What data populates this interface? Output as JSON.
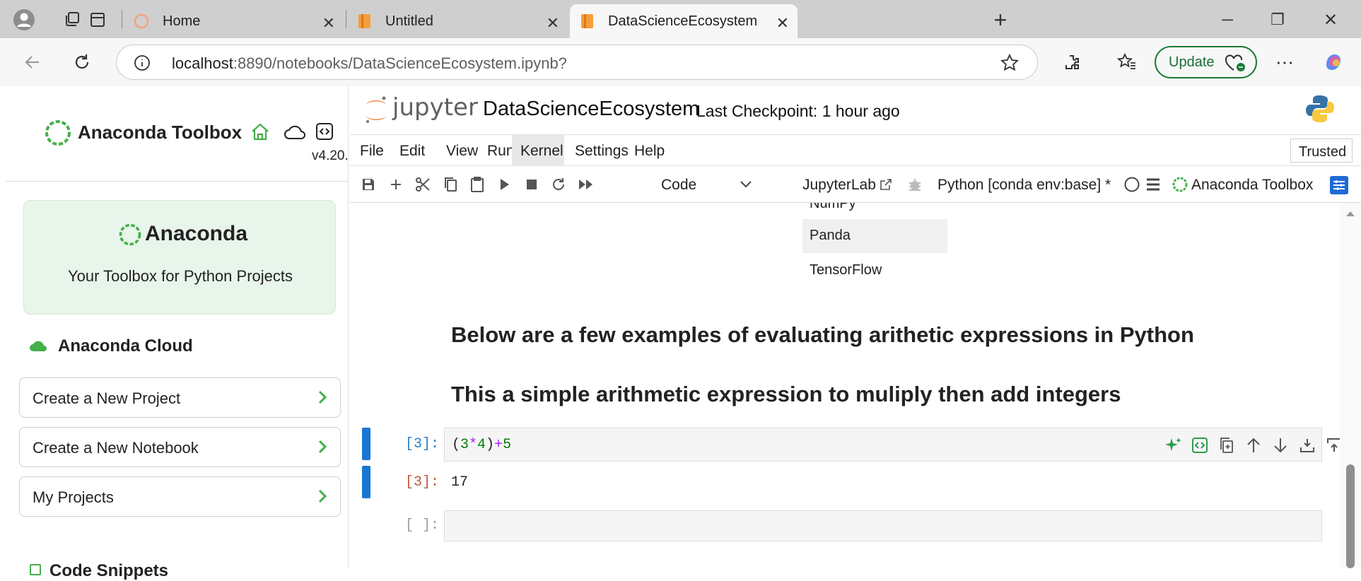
{
  "browser": {
    "tabs": [
      {
        "title": "Home",
        "active": false
      },
      {
        "title": "Untitled",
        "active": false
      },
      {
        "title": "DataScienceEcosystem",
        "active": true
      }
    ],
    "close_glyph": "✕",
    "new_tab_glyph": "+",
    "url_host": "localhost",
    "url_rest": ":8890/notebooks/DataScienceEcosystem.ipynb?",
    "update_label": "Update",
    "window_controls": {
      "minimize": "─",
      "restore": "❐",
      "close": "✕"
    }
  },
  "sidebar": {
    "title": "Anaconda Toolbox",
    "version": "v4.20.",
    "card_title": "Anaconda",
    "card_subtitle": "Your Toolbox for Python Projects",
    "cloud_title": "Anaconda Cloud",
    "buttons": [
      {
        "label": "Create a New Project"
      },
      {
        "label": "Create a New Notebook"
      },
      {
        "label": "My Projects"
      }
    ],
    "snippets_title": "Code Snippets",
    "brand_color": "#43b049"
  },
  "jupyter": {
    "logo_text": "jupyter",
    "notebook_name": "DataScienceEcosystem",
    "checkpoint": "Last Checkpoint: 1 hour ago",
    "menus": [
      "File",
      "Edit",
      "View",
      "Run",
      "Kernel",
      "Settings",
      "Help"
    ],
    "highlighted_menu": "Kernel",
    "trusted": "Trusted",
    "cell_type": "Code",
    "jupyterlab_link": "JupyterLab",
    "kernel_name": "Python [conda env:base] *",
    "toolbox_label": "Anaconda Toolbox"
  },
  "notebook": {
    "list_items": [
      "NumPy",
      "Panda",
      "TensorFlow"
    ],
    "heading1": "Below are a few examples of evaluating arithetic expressions in Python",
    "heading2": "This a simple arithmetic expression to muliply then add integers",
    "code_prompt": "[3]:",
    "code": {
      "p1": "(",
      "n1": "3",
      "op1": "*",
      "n2": "4",
      "p2": ")",
      "op2": "+",
      "n3": "5"
    },
    "out_prompt": "[3]:",
    "output": "17",
    "empty_prompt": "[ ]:",
    "input_prompt_color": "#307fc1",
    "output_prompt_color": "#bf5b3d"
  }
}
